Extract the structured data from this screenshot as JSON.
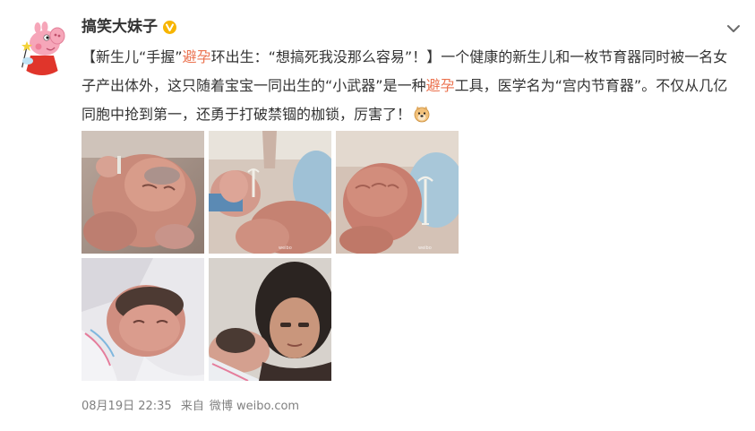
{
  "user": {
    "name": "搞笑大妹子",
    "badge": "verified-gold-v-icon",
    "avatar": "peppa-pig-avatar"
  },
  "post": {
    "segments": [
      {
        "text": "【新生儿“手握”",
        "highlight": false
      },
      {
        "text": "避孕",
        "highlight": true
      },
      {
        "text": "环出生：“想搞死我没那么容易”！】一个健康的新生儿和一枚节育器同时被一名女子产出体外，这只随着宝宝一同出生的“小武器”是一种",
        "highlight": false
      },
      {
        "text": "避孕",
        "highlight": true
      },
      {
        "text": "工具，医学名为“宫内节育器”。不仅从几亿同胞中抢到第一，还勇于打破禁锢的枷锁，厉害了！",
        "highlight": false
      }
    ],
    "emoji": "doge-emoji-icon"
  },
  "photos": [
    {
      "name": "photo-newborn-holding-iud",
      "watermark": false
    },
    {
      "name": "photo-fist-with-iud",
      "watermark": true
    },
    {
      "name": "photo-fist-closeup-iud",
      "watermark": true
    },
    {
      "name": "photo-newborn-swaddled",
      "watermark": false
    },
    {
      "name": "photo-mother-with-baby",
      "watermark": false
    }
  ],
  "meta": {
    "date": "08月19日 22:35",
    "from_label": "来自",
    "source": "微博 weibo.com"
  },
  "colors": {
    "highlight": "#eb7350",
    "text": "#333333",
    "meta": "#808080",
    "badge": "#f7b500"
  }
}
